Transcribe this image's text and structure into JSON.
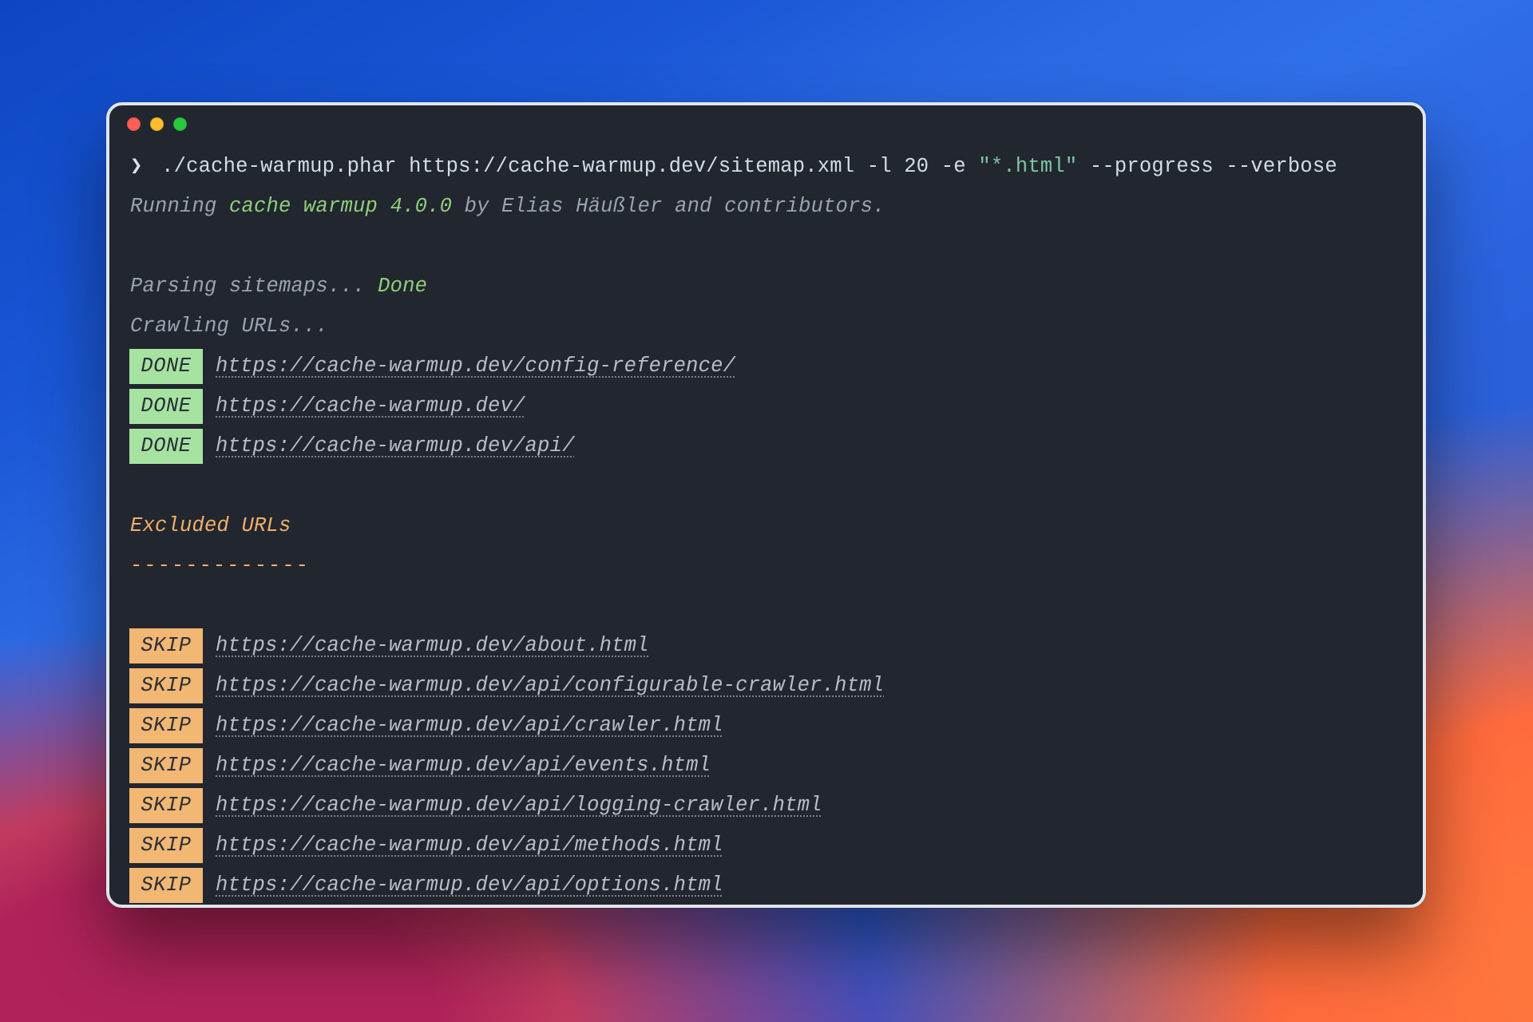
{
  "prompt": {
    "symbol": "❯",
    "command": "./cache-warmup.phar",
    "arg": "https://cache-warmup.dev/sitemap.xml",
    "flags_a": "-l 20 -e",
    "pattern": "\"*.html\"",
    "flags_b": "--progress --verbose"
  },
  "running": {
    "prefix": "Running ",
    "name": "cache warmup 4.0.0",
    "suffix": " by Elias Häußler and contributors."
  },
  "parsing": {
    "label": "Parsing sitemaps... ",
    "status": "Done"
  },
  "crawling_label": "Crawling URLs...",
  "done_rows": [
    {
      "badge": "DONE",
      "url": "https://cache-warmup.dev/config-reference/"
    },
    {
      "badge": "DONE",
      "url": "https://cache-warmup.dev/"
    },
    {
      "badge": "DONE",
      "url": "https://cache-warmup.dev/api/"
    }
  ],
  "excluded": {
    "title": "Excluded URLs",
    "divider": "-------------"
  },
  "skip_rows": [
    {
      "badge": "SKIP",
      "url": "https://cache-warmup.dev/about.html"
    },
    {
      "badge": "SKIP",
      "url": "https://cache-warmup.dev/api/configurable-crawler.html"
    },
    {
      "badge": "SKIP",
      "url": "https://cache-warmup.dev/api/crawler.html"
    },
    {
      "badge": "SKIP",
      "url": "https://cache-warmup.dev/api/events.html"
    },
    {
      "badge": "SKIP",
      "url": "https://cache-warmup.dev/api/logging-crawler.html"
    },
    {
      "badge": "SKIP",
      "url": "https://cache-warmup.dev/api/methods.html"
    },
    {
      "badge": "SKIP",
      "url": "https://cache-warmup.dev/api/options.html"
    }
  ]
}
